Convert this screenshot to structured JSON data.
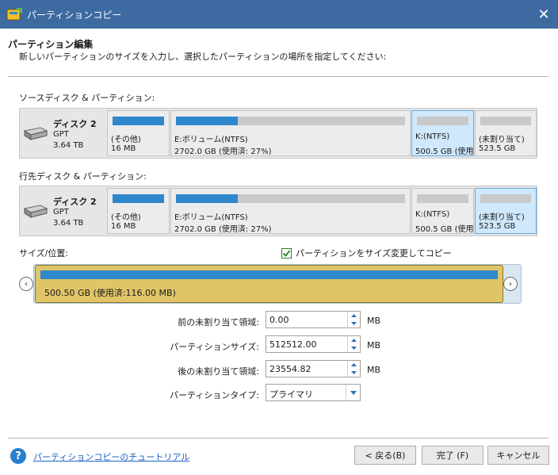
{
  "window": {
    "title": "パーティションコピー",
    "close_glyph": "✕"
  },
  "header": {
    "title": "パーティション編集",
    "subtitle": "新しいパーティションのサイズを入力し、選択したパーティションの場所を指定してください:"
  },
  "source": {
    "label": "ソースディスク & パーティション:",
    "disk": {
      "name": "ディスク 2",
      "type": "GPT",
      "size": "3.64 TB"
    },
    "partitions": [
      {
        "label": "(その他)",
        "size": "16 MB",
        "used_fraction": 1.0,
        "selected": false
      },
      {
        "label": "E:ボリューム(NTFS)",
        "size": "2702.0 GB (使用済: 27%)",
        "used_fraction": 0.27,
        "selected": false
      },
      {
        "label": "K:(NTFS)",
        "size": "500.5 GB (使用",
        "used_fraction": 0.0,
        "selected": true
      },
      {
        "label": "(未割り当て)",
        "size": "523.5 GB",
        "used_fraction": 0.0,
        "selected": false
      }
    ]
  },
  "target": {
    "label": "行先ディスク & パーティション:",
    "disk": {
      "name": "ディスク 2",
      "type": "GPT",
      "size": "3.64 TB"
    },
    "partitions": [
      {
        "label": "(その他)",
        "size": "16 MB",
        "used_fraction": 1.0,
        "selected": false
      },
      {
        "label": "E:ボリューム(NTFS)",
        "size": "2702.0 GB (使用済: 27%)",
        "used_fraction": 0.27,
        "selected": false
      },
      {
        "label": "K:(NTFS)",
        "size": "500.5 GB (使用",
        "used_fraction": 0.0,
        "selected": false
      },
      {
        "label": "(未割り当て)",
        "size": "523.5 GB",
        "used_fraction": 0.0,
        "selected": true
      }
    ]
  },
  "resize": {
    "label": "サイズ/位置:",
    "checkbox_label": "パーティションをサイズ変更してコピー",
    "checkbox_checked": true,
    "bar_text": "500.50 GB (使用済:116.00 MB)",
    "left_arrow": "‹",
    "right_arrow": "›"
  },
  "fields": [
    {
      "label": "前の未割り当て領域:",
      "value": "0.00",
      "unit": "MB"
    },
    {
      "label": "パーティションサイズ:",
      "value": "512512.00",
      "unit": "MB"
    },
    {
      "label": "後の未割り当て領域:",
      "value": "23554.82",
      "unit": "MB"
    }
  ],
  "partition_type": {
    "label": "パーティションタイプ:",
    "value": "プライマリ"
  },
  "footer": {
    "help_glyph": "?",
    "tutorial_link": "パーティションコピーのチュートリアル",
    "back": "< 戻る(B)",
    "finish": "完了 (F)",
    "cancel": "キャンセル"
  },
  "colors": {
    "titlebar": "#3d6aa1",
    "accent": "#2f87cc",
    "selection": "#dfc568",
    "link": "#1e63c5"
  }
}
